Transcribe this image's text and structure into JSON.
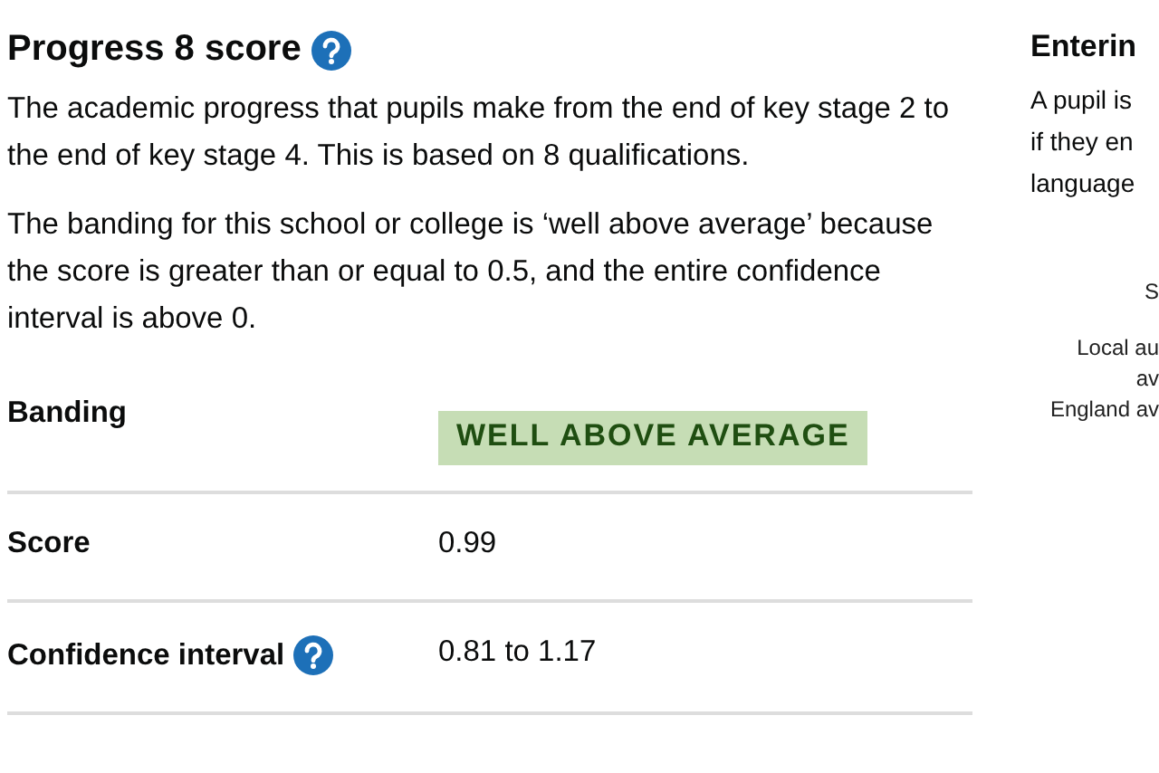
{
  "progress": {
    "title": "Progress 8 score",
    "paragraphs": [
      "The academic progress that pupils make from the end of key stage 2 to the end of key stage 4. This is based on 8 qualifications.",
      "The banding for this school or college is ‘well above average’ because the score is greater than or equal to 0.5, and the entire confidence interval is above 0."
    ],
    "rows": [
      {
        "kind": "tag",
        "label": "Banding",
        "help": false,
        "value": "WELL ABOVE AVERAGE"
      },
      {
        "kind": "text",
        "label": "Score",
        "help": false,
        "value": "0.99"
      },
      {
        "kind": "text",
        "label": "Confidence interval",
        "help": true,
        "value": "0.81 to 1.17"
      }
    ]
  },
  "entering": {
    "title": "Enterin",
    "lines": [
      "A pupil is",
      "if they en",
      "language"
    ],
    "chart_labels": [
      "S",
      "Local au",
      "av",
      "England av"
    ]
  }
}
